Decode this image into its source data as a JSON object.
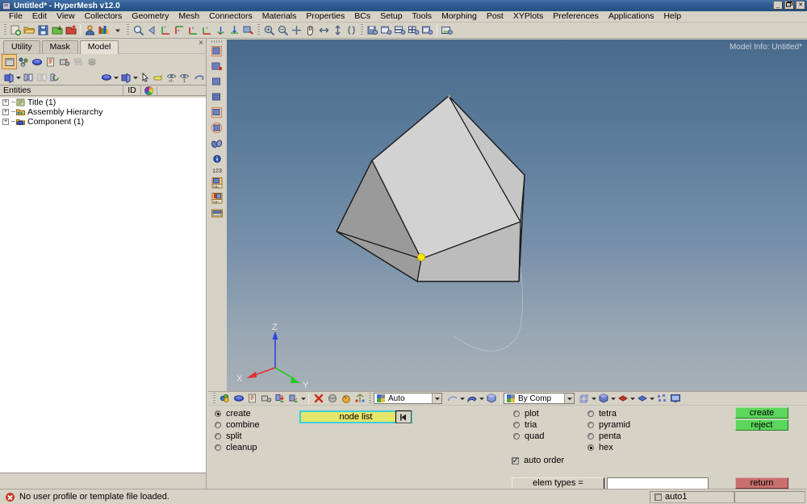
{
  "window": {
    "title": "Untitled* - HyperMesh v12.0",
    "app_icon": "hypermesh-window-icon",
    "minimize": "_",
    "restore": "❐",
    "close": "✕"
  },
  "menubar": {
    "items": [
      {
        "label": "File"
      },
      {
        "label": "Edit"
      },
      {
        "label": "View"
      },
      {
        "label": "Collectors"
      },
      {
        "label": "Geometry"
      },
      {
        "label": "Mesh"
      },
      {
        "label": "Connectors"
      },
      {
        "label": "Materials"
      },
      {
        "label": "Properties"
      },
      {
        "label": "BCs"
      },
      {
        "label": "Setup"
      },
      {
        "label": "Tools"
      },
      {
        "label": "Morphing"
      },
      {
        "label": "Post"
      },
      {
        "label": "XYPlots"
      },
      {
        "label": "Preferences"
      },
      {
        "label": "Applications"
      },
      {
        "label": "Help"
      }
    ]
  },
  "toolbar_top": {
    "groups": [
      {
        "name": "file-group",
        "buttons": [
          {
            "icon": "new-model-icon",
            "tip": "New"
          },
          {
            "icon": "open-model-icon",
            "tip": "Open"
          },
          {
            "icon": "save-model-icon",
            "tip": "Save"
          },
          {
            "icon": "import-icon",
            "tip": "Import"
          },
          {
            "icon": "export-icon",
            "tip": "Export"
          }
        ]
      },
      {
        "name": "user-group",
        "buttons": [
          {
            "icon": "user-profile-icon",
            "tip": "User Profiles"
          },
          {
            "icon": "color-palette-icon",
            "tip": "Display Colors"
          }
        ]
      },
      {
        "name": "view-group",
        "buttons": [
          {
            "icon": "fit-view-icon",
            "tip": "Fit"
          },
          {
            "icon": "back-arrow-icon",
            "tip": "Previous View"
          },
          {
            "icon": "yz-view-icon",
            "tip": "YZ Left Plane View"
          },
          {
            "icon": "xz-view-icon",
            "tip": "XZ Top Plane View"
          },
          {
            "icon": "zx-view-icon",
            "tip": "ZX Plane View"
          },
          {
            "icon": "xy-view-icon",
            "tip": "XY Plane View"
          },
          {
            "icon": "iso-view-icon",
            "tip": "Isometric View"
          },
          {
            "icon": "rotate-view-icon",
            "tip": "Rotate View"
          },
          {
            "icon": "flag-view-icon",
            "tip": "Set View"
          }
        ]
      },
      {
        "name": "navigate-group",
        "buttons": [
          {
            "icon": "zoom-in-icon",
            "tip": "Zoom In"
          },
          {
            "icon": "zoom-out-icon",
            "tip": "Zoom Out"
          },
          {
            "icon": "center-icon",
            "tip": "Center"
          },
          {
            "icon": "pan-hand-icon",
            "tip": "Pan"
          },
          {
            "icon": "arrow-move-icon",
            "tip": "Move"
          },
          {
            "icon": "arrow-updown-icon",
            "tip": "Vertical Move"
          },
          {
            "icon": "brackets-icon",
            "tip": "Circle Zoom"
          }
        ]
      },
      {
        "name": "window-group",
        "buttons": [
          {
            "icon": "save-window-icon",
            "tip": "Save Window"
          },
          {
            "icon": "single-window-icon",
            "tip": "1 Window"
          },
          {
            "icon": "two-window-icon",
            "tip": "2 Windows"
          },
          {
            "icon": "four-window-icon",
            "tip": "4 Windows"
          },
          {
            "icon": "window-layout-icon",
            "tip": "Window Layout"
          },
          {
            "icon": "image-capture-icon",
            "tip": "Capture Image"
          }
        ]
      }
    ]
  },
  "left_panel": {
    "close_icon": "×",
    "tabs": [
      {
        "label": "Utility",
        "active": false
      },
      {
        "label": "Mask",
        "active": false
      },
      {
        "label": "Model",
        "active": true
      }
    ],
    "toolbar_row1": [
      {
        "icon": "model-view-icon",
        "active": true
      },
      {
        "icon": "assembly-icon",
        "active": false
      },
      {
        "icon": "component-icon",
        "active": false
      },
      {
        "icon": "include-icon",
        "active": false
      },
      {
        "icon": "property-icon",
        "active": false
      },
      {
        "icon": "disabled-stack-icon",
        "active": false
      },
      {
        "icon": "disabled-cards-icon",
        "active": false
      }
    ],
    "toolbar_row2": [
      {
        "icon": "isolate-icon"
      },
      {
        "icon": "dropdown-dot-1"
      },
      {
        "icon": "reverse-icon"
      },
      {
        "icon": "unmask-icon"
      },
      {
        "icon": "refresh-icon"
      },
      {
        "icon": "blue-disc-icon"
      },
      {
        "icon": "dropdown-dot-2"
      },
      {
        "icon": "element-icon"
      },
      {
        "icon": "dropdown-dot-3"
      },
      {
        "icon": "cursor-arrow-icon"
      },
      {
        "icon": "highlight-icon"
      },
      {
        "icon": "eye-plusminus-icon"
      },
      {
        "icon": "eye-one-icon"
      },
      {
        "icon": "undo-arc-icon"
      }
    ],
    "columns": [
      {
        "label": "Entities"
      },
      {
        "label": "ID"
      },
      {
        "label": "color-wheel-icon"
      },
      {
        "label": ""
      }
    ],
    "tree": [
      {
        "label": "Title (1)",
        "icon": "title-icon",
        "expander": "+"
      },
      {
        "label": "Assembly Hierarchy",
        "icon": "assembly-folder-icon",
        "expander": "+"
      },
      {
        "label": "Component (1)",
        "icon": "component-blue-icon",
        "expander": "+"
      }
    ]
  },
  "vertical_toolbar": {
    "buttons": [
      {
        "icon": "page-geom-icon",
        "highlight": true
      },
      {
        "icon": "page-mesh-red-icon",
        "highlight": false
      },
      {
        "icon": "page-grid-icon",
        "highlight": false
      },
      {
        "icon": "page-grid2-icon",
        "highlight": false
      },
      {
        "icon": "page-grid-box-icon",
        "highlight": true
      },
      {
        "icon": "page-circle-icon",
        "highlight": true
      },
      {
        "icon": "binoculars-icon",
        "highlight": false
      },
      {
        "icon": "info-blue-icon",
        "highlight": false
      },
      {
        "icon": "numbers-123-icon",
        "highlight": false
      },
      {
        "icon": "abc-label-icon",
        "highlight": false
      },
      {
        "icon": "abc-pin-icon",
        "highlight": false
      },
      {
        "icon": "legend-bar-icon",
        "highlight": false
      }
    ]
  },
  "viewport": {
    "model_info": "Model Info: Untitled*",
    "axes": [
      {
        "name": "x-axis",
        "label": "X",
        "color": "#e03030"
      },
      {
        "name": "y-axis",
        "label": "Y",
        "color": "#28c828"
      },
      {
        "name": "z-axis",
        "label": "Z",
        "color": "#3040e0"
      }
    ],
    "node_marker_color": "#ffe800",
    "face_colors": {
      "top": "#d2d2d2",
      "right": "#c4c4c4",
      "front": "#b0b0b0",
      "left": "#9c9c9c"
    }
  },
  "command_panel": {
    "toolbar": [
      {
        "icon": "collector-create-icon"
      },
      {
        "icon": "collector-blue-icon"
      },
      {
        "icon": "collector-card-icon"
      },
      {
        "icon": "collector-mesh-icon"
      },
      {
        "icon": "collector-down-icon"
      },
      {
        "icon": "collector-arrow-icon"
      },
      {
        "icon": "dropdown-dot-a"
      },
      {
        "icon": "delete-red-x-icon"
      },
      {
        "icon": "mask-sphere-icon"
      },
      {
        "icon": "orange-ball-icon"
      },
      {
        "icon": "organize-icon"
      }
    ],
    "mode_combo": {
      "value": "Auto",
      "icon": "color-cube-icon"
    },
    "shade_buttons": [
      {
        "icon": "wireframe-icon"
      },
      {
        "icon": "dropdown-dot-b"
      },
      {
        "icon": "shaded-icon"
      },
      {
        "icon": "dropdown-dot-c"
      },
      {
        "icon": "solid-cube-icon"
      }
    ],
    "bycomp_combo": {
      "value": "By Comp",
      "icon": "color-cube2-icon"
    },
    "view_buttons": [
      {
        "icon": "wire-cube-icon"
      },
      {
        "icon": "dropdown-dot-d"
      },
      {
        "icon": "shaded-cube-icon"
      },
      {
        "icon": "dropdown-dot-e"
      },
      {
        "icon": "red-diamond-icon"
      },
      {
        "icon": "dropdown-dot-f"
      },
      {
        "icon": "blue-diamond-icon"
      },
      {
        "icon": "dropdown-dot-g"
      },
      {
        "icon": "nodes-icon"
      },
      {
        "icon": "monitor-icon"
      }
    ],
    "operation_radios": [
      {
        "label": "create",
        "selected": true
      },
      {
        "label": "combine",
        "selected": false
      },
      {
        "label": "split",
        "selected": false
      },
      {
        "label": "cleanup",
        "selected": false
      }
    ],
    "node_list": {
      "label": "node list",
      "reset_icon": "◀|"
    },
    "element_radios_2d": [
      {
        "label": "plot",
        "selected": false
      },
      {
        "label": "tria",
        "selected": false
      },
      {
        "label": "quad",
        "selected": false
      }
    ],
    "element_radios_3d": [
      {
        "label": "tetra",
        "selected": false
      },
      {
        "label": "pyramid",
        "selected": false
      },
      {
        "label": "penta",
        "selected": false
      },
      {
        "label": "hex",
        "selected": true
      }
    ],
    "auto_order": {
      "label": "auto order",
      "checked": true,
      "mark": "✓"
    },
    "action_buttons": [
      {
        "label": "create",
        "style": "green"
      },
      {
        "label": "reject",
        "style": "green"
      }
    ],
    "return_button": {
      "label": "return",
      "style": "red"
    },
    "elem_types_button": {
      "label": "elem types ="
    },
    "elem_types_field": {
      "value": ""
    }
  },
  "status_bar": {
    "message": "No user profile or template file loaded.",
    "error_icon": "error-icon",
    "cells": [
      {
        "name": "status-cell-left",
        "label": ""
      },
      {
        "name": "status-cell-auto",
        "label": "auto1",
        "checkbox": true
      },
      {
        "name": "status-cell-right",
        "label": ""
      }
    ]
  }
}
